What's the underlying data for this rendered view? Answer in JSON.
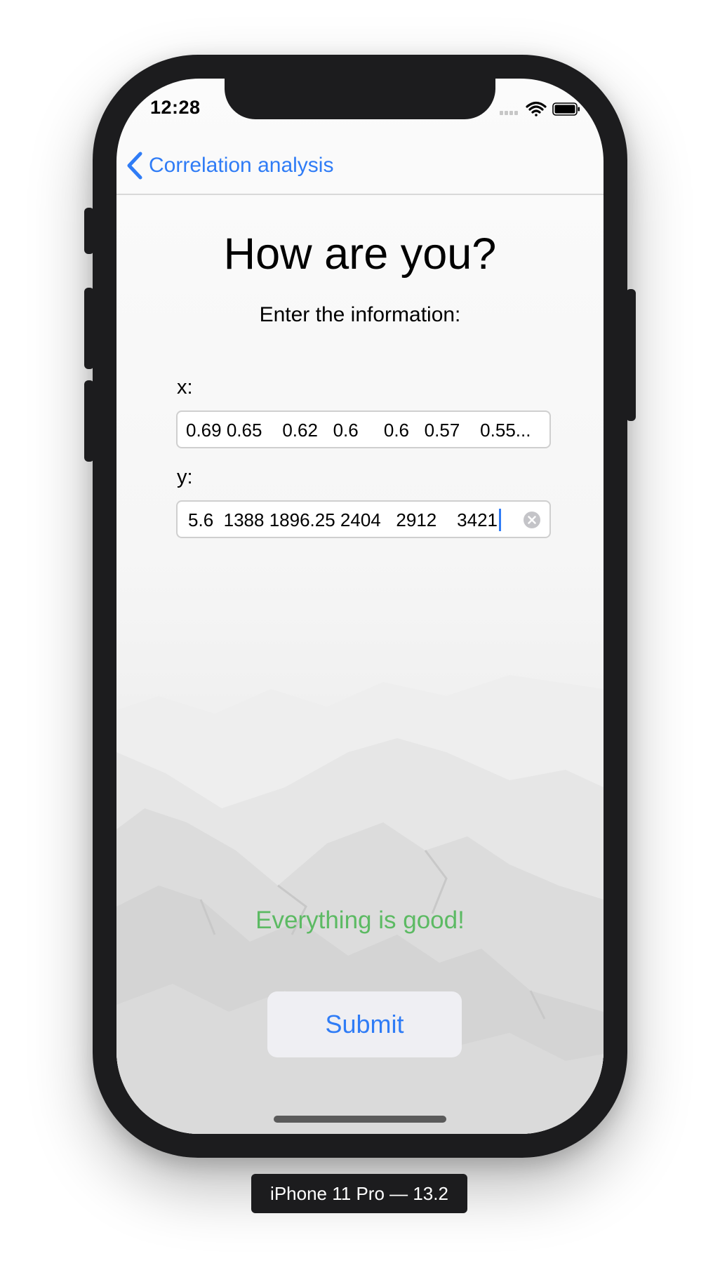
{
  "status_bar": {
    "time": "12:28",
    "icons": [
      "cellular-signal-icon",
      "wifi-icon",
      "battery-icon"
    ]
  },
  "nav": {
    "back_icon": "chevron-left-icon",
    "back_label": "Correlation analysis"
  },
  "main": {
    "title": "How are you?",
    "subtitle": "Enter the information:",
    "x_field": {
      "label": "x:",
      "value": "0.69 0.65    0.62   0.6     0.6   0.57    0.55..."
    },
    "y_field": {
      "label": "y:",
      "value": "5.6  1388 1896.25 2404   2912    3421",
      "clear_icon": "clear-circle-icon"
    },
    "status_message": "Everything is good!",
    "submit_label": "Submit"
  },
  "device": {
    "label": "iPhone 11 Pro — 13.2"
  },
  "colors": {
    "accent": "#2f7cf6",
    "success": "#5cba63",
    "device_frame": "#1c1c1e"
  }
}
